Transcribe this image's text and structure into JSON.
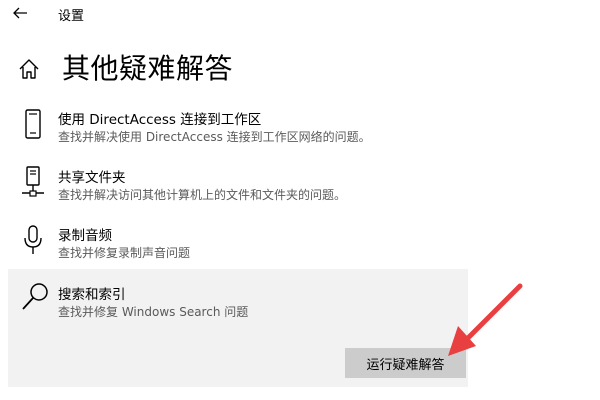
{
  "app": {
    "title": "设置",
    "back_icon": "back-arrow-icon"
  },
  "page": {
    "title": "其他疑难解答",
    "home_icon": "home-icon"
  },
  "troubleshooters": [
    {
      "title": "使用 DirectAccess 连接到工作区",
      "description": "查找并解决使用 DirectAccess 连接到工作区网络的问题。",
      "icon": "phone-icon"
    },
    {
      "title": "共享文件夹",
      "description": "查找并解决访问其他计算机上的文件和文件夹的问题。",
      "icon": "network-share-icon"
    },
    {
      "title": "录制音频",
      "description": "查找并修复录制声音问题",
      "icon": "microphone-icon"
    },
    {
      "title": "搜索和索引",
      "description": "查找并修复 Windows Search 问题",
      "icon": "search-icon",
      "selected": true,
      "button_label": "运行疑难解答"
    }
  ],
  "colors": {
    "selected_bg": "#f2f2f2",
    "button_bg": "#cccccc",
    "annotation_arrow": "#e84040"
  }
}
